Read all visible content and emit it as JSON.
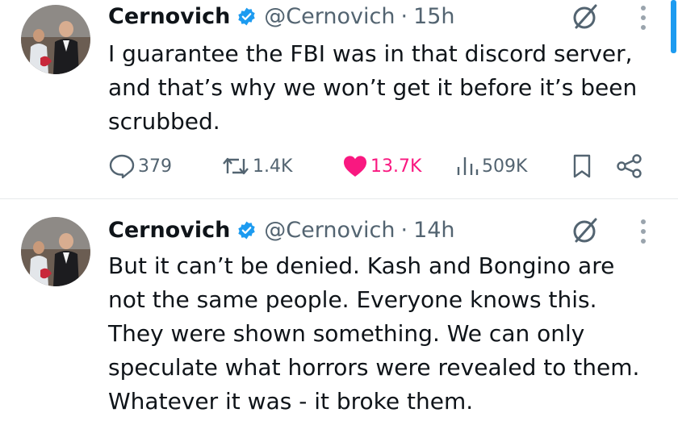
{
  "colors": {
    "accent": "#1d9bf0",
    "like": "#f91880",
    "muted": "#536471",
    "text": "#0f1419"
  },
  "tweets": [
    {
      "name": "Cernovich",
      "handle": "@Cernovich",
      "separator": "·",
      "time": "15h",
      "text": "I guarantee the FBI was in that discord server,\nand that’s why we won’t get it before it’s been\nscrubbed.",
      "replies": "379",
      "reposts": "1.4K",
      "likes": "13.7K",
      "views": "509K",
      "liked": true
    },
    {
      "name": "Cernovich",
      "handle": "@Cernovich",
      "separator": "·",
      "time": "14h",
      "text": "But it can’t be denied. Kash and Bongino are\nnot the same people. Everyone knows this.\nThey were shown something. We can only\nspeculate what horrors were revealed to them.\nWhatever it was - it broke them."
    }
  ],
  "icons": {
    "verified": "verified-badge-icon",
    "grok": "grok-icon",
    "more": "more-vertical-icon",
    "reply": "reply-icon",
    "repost": "repost-icon",
    "like": "heart-icon",
    "views": "views-icon",
    "bookmark": "bookmark-icon",
    "share": "share-icon"
  }
}
